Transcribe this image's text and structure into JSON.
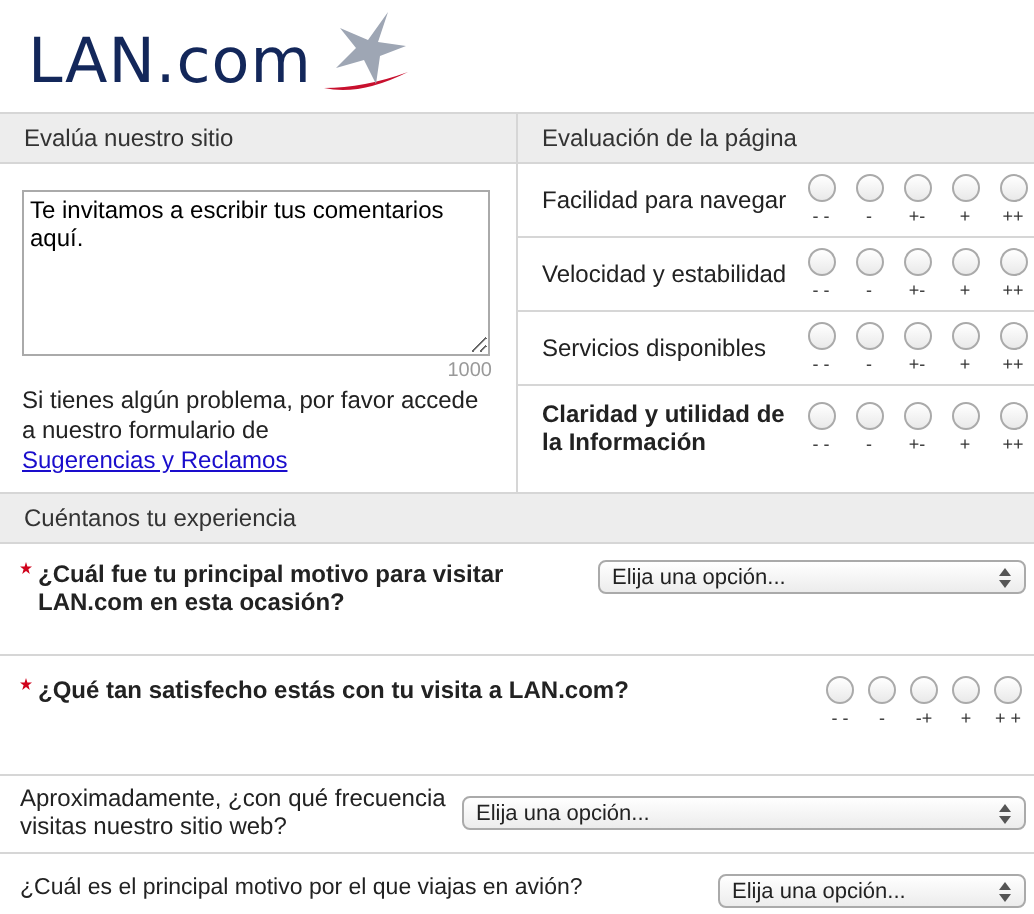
{
  "logo": {
    "text": "LAN.com"
  },
  "evaluate_site": {
    "heading": "Evalúa nuestro sitio",
    "comment": {
      "value": "Te invitamos a escribir tus comentarios aquí.",
      "counter": "1000"
    },
    "help_text": "Si tienes algún problema, por favor accede a nuestro formulario de ",
    "help_link": "Sugerencias y Reclamos"
  },
  "page_rating": {
    "heading": "Evaluación de la página",
    "criteria": [
      {
        "label": "Facilidad para navegar",
        "emphasized": false,
        "options": [
          {
            "label": "- -",
            "selected": false
          },
          {
            "label": "-",
            "selected": false
          },
          {
            "label": "+-",
            "selected": false
          },
          {
            "label": "+",
            "selected": false
          },
          {
            "label": "++",
            "selected": false
          }
        ]
      },
      {
        "label": "Velocidad y estabilidad",
        "emphasized": false,
        "options": [
          {
            "label": "- -",
            "selected": false
          },
          {
            "label": "-",
            "selected": false
          },
          {
            "label": "+-",
            "selected": false
          },
          {
            "label": "+",
            "selected": false
          },
          {
            "label": "++",
            "selected": false
          }
        ]
      },
      {
        "label": "Servicios disponibles",
        "emphasized": false,
        "options": [
          {
            "label": "- -",
            "selected": false
          },
          {
            "label": "-",
            "selected": false
          },
          {
            "label": "+-",
            "selected": false
          },
          {
            "label": "+",
            "selected": false
          },
          {
            "label": "++",
            "selected": false
          }
        ]
      },
      {
        "label": "Claridad y utilidad de la Información",
        "emphasized": true,
        "options": [
          {
            "label": "- -",
            "selected": false
          },
          {
            "label": "-",
            "selected": false
          },
          {
            "label": "+-",
            "selected": false
          },
          {
            "label": "+",
            "selected": false
          },
          {
            "label": "++",
            "selected": false
          }
        ]
      }
    ]
  },
  "experience": {
    "heading": "Cuéntanos tu experiencia",
    "questions": [
      {
        "kind": "select",
        "required": true,
        "label": "¿Cuál fue tu principal motivo para visitar LAN.com en esta ocasión?",
        "placeholder": "Elija una opción..."
      },
      {
        "kind": "rating",
        "required": true,
        "label": "¿Qué tan satisfecho estás con tu visita a LAN.com?",
        "options": [
          {
            "label": "- -",
            "selected": false
          },
          {
            "label": "-",
            "selected": false
          },
          {
            "label": "-+",
            "selected": false
          },
          {
            "label": "+",
            "selected": false
          },
          {
            "label": "+ +",
            "selected": false
          }
        ]
      },
      {
        "kind": "select",
        "required": false,
        "label": "Aproximadamente, ¿con qué frecuencia visitas nuestro sitio web?",
        "placeholder": "Elija una opción..."
      },
      {
        "kind": "select",
        "required": false,
        "label": "¿Cuál es el principal motivo por el que viajas en avión?",
        "placeholder": "Elija una opción..."
      }
    ]
  }
}
